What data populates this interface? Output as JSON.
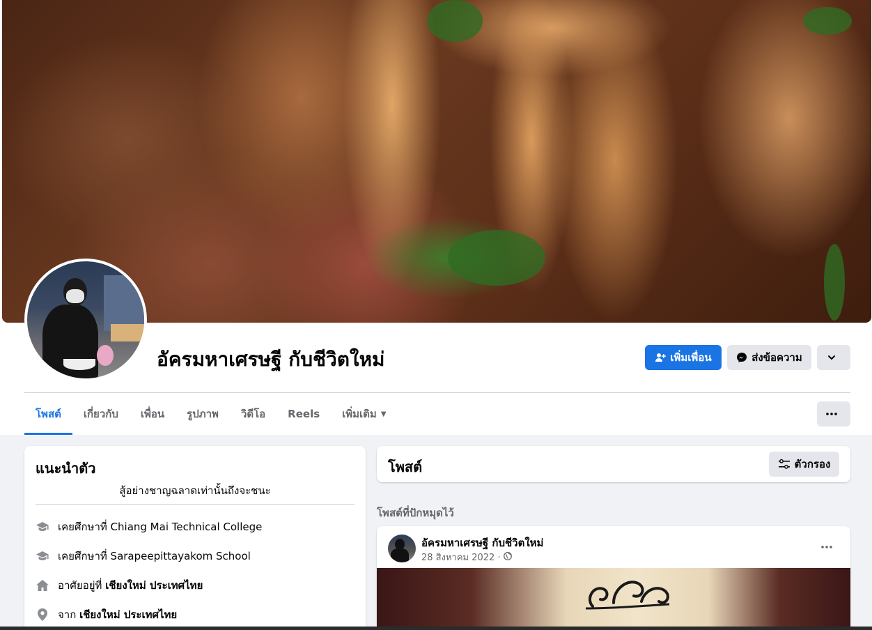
{
  "profile": {
    "name": "อัครมหาเศรษฐี กับชีวิตใหม่"
  },
  "actions": {
    "add_friend": "เพิ่มเพื่อน",
    "message": "ส่งข้อความ"
  },
  "tabs": [
    {
      "label": "โพสต์",
      "active": true
    },
    {
      "label": "เกี่ยวกับ",
      "active": false
    },
    {
      "label": "เพื่อน",
      "active": false
    },
    {
      "label": "รูปภาพ",
      "active": false
    },
    {
      "label": "วิดีโอ",
      "active": false
    },
    {
      "label": "Reels",
      "active": false
    },
    {
      "label": "เพิ่มเติม",
      "active": false
    }
  ],
  "intro": {
    "title": "แนะนำตัว",
    "bio": "สู้อย่างชาญฉลาดเท่านั้นถึงจะชนะ",
    "items": [
      {
        "icon": "graduation-cap-icon",
        "prefix": "เคยศึกษาที่",
        "value": "Chiang Mai Technical College"
      },
      {
        "icon": "graduation-cap-icon",
        "prefix": "เคยศึกษาที่",
        "value": "Sarapeepittayakom School"
      },
      {
        "icon": "home-icon",
        "prefix": "อาศัยอยู่ที่",
        "value": "เชียงใหม่ ประเทศไทย"
      },
      {
        "icon": "location-pin-icon",
        "prefix": "จาก",
        "value": "เชียงใหม่ ประเทศไทย"
      }
    ]
  },
  "posts": {
    "title": "โพสต์",
    "filter_label": "ตัวกรอง",
    "pinned_label": "โพสต์ที่ปักหมุดไว้"
  },
  "post": {
    "author": "อัครมหาเศรษฐี กับชีวิตใหม่",
    "date": "28 สิงหาคม 2022 ·",
    "privacy_icon": "globe-icon"
  },
  "colors": {
    "accent": "#1b74e4",
    "background": "#f0f2f5",
    "secondary_text": "#65676b"
  }
}
